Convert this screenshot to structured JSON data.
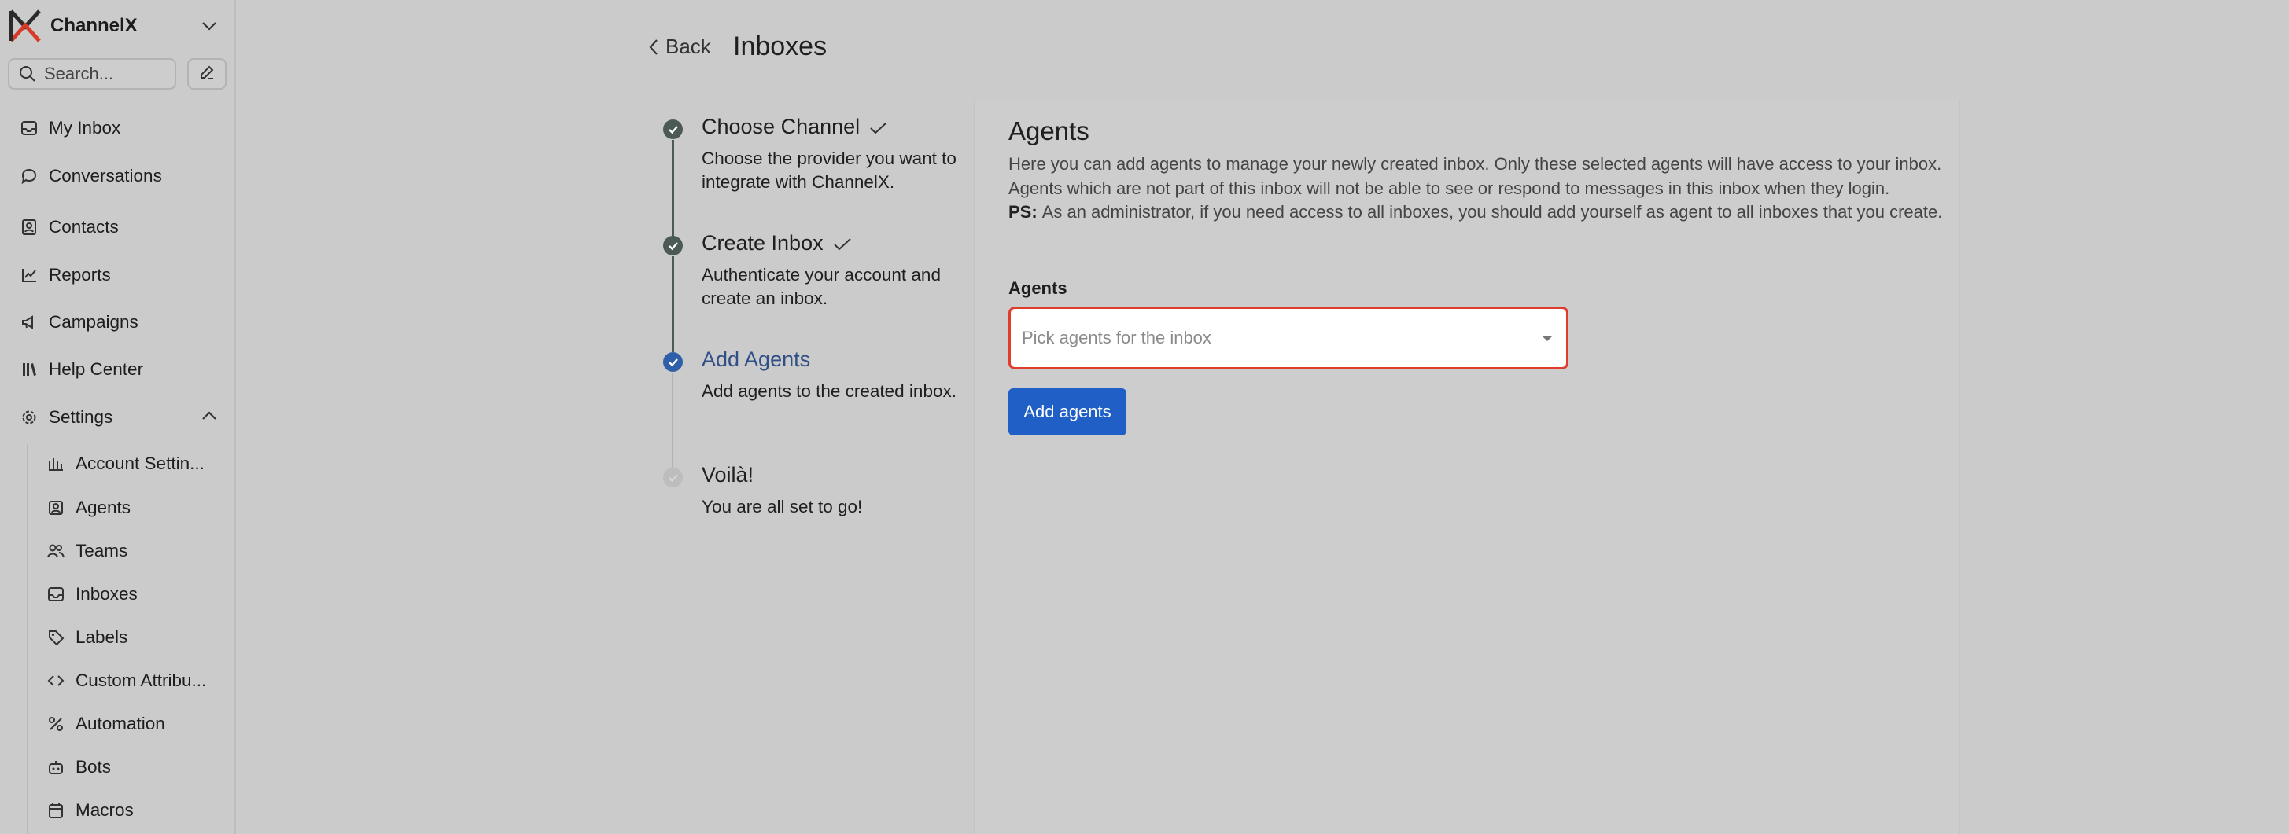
{
  "brand": {
    "name": "ChannelX"
  },
  "search": {
    "placeholder": "Search..."
  },
  "nav": {
    "items": [
      {
        "label": "My Inbox",
        "icon": "inbox-icon"
      },
      {
        "label": "Conversations",
        "icon": "chat-bubble-icon"
      },
      {
        "label": "Contacts",
        "icon": "contact-card-icon"
      },
      {
        "label": "Reports",
        "icon": "line-chart-icon"
      },
      {
        "label": "Campaigns",
        "icon": "megaphone-icon"
      },
      {
        "label": "Help Center",
        "icon": "library-icon"
      },
      {
        "label": "Settings",
        "icon": "gear-icon"
      }
    ],
    "settings_items": [
      {
        "label": "Account Settin...",
        "icon": "account-settings-icon"
      },
      {
        "label": "Agents",
        "icon": "person-square-icon"
      },
      {
        "label": "Teams",
        "icon": "people-icon"
      },
      {
        "label": "Inboxes",
        "icon": "inbox-icon"
      },
      {
        "label": "Labels",
        "icon": "tag-icon"
      },
      {
        "label": "Custom Attribu...",
        "icon": "code-icon"
      },
      {
        "label": "Automation",
        "icon": "percent-automation-icon"
      },
      {
        "label": "Bots",
        "icon": "robot-icon"
      },
      {
        "label": "Macros",
        "icon": "calendar-icon"
      }
    ]
  },
  "header": {
    "back_label": "Back",
    "title": "Inboxes"
  },
  "steps": [
    {
      "title": "Choose Channel",
      "desc": "Choose the provider you want to integrate with ChannelX.",
      "state": "done"
    },
    {
      "title": "Create Inbox",
      "desc": "Authenticate your account and create an inbox.",
      "state": "done"
    },
    {
      "title": "Add Agents",
      "desc": "Add agents to the created inbox.",
      "state": "active"
    },
    {
      "title": "Voilà!",
      "desc": "You are all set to go!",
      "state": "pending"
    }
  ],
  "panel": {
    "title": "Agents",
    "description": "Here you can add agents to manage your newly created inbox. Only these selected agents will have access to your inbox. Agents which are not part of this inbox will not be able to see or respond to messages in this inbox when they login.",
    "ps_label": "PS:",
    "ps_text": "As an administrator, if you need access to all inboxes, you should add yourself as agent to all inboxes that you create.",
    "field_label": "Agents",
    "select_placeholder": "Pick agents for the inbox",
    "button_label": "Add agents"
  },
  "colors": {
    "accent": "#1f5fc6",
    "error_border": "#e03c2c",
    "step_done": "#4b5a54",
    "step_active": "#2f5fa8"
  }
}
